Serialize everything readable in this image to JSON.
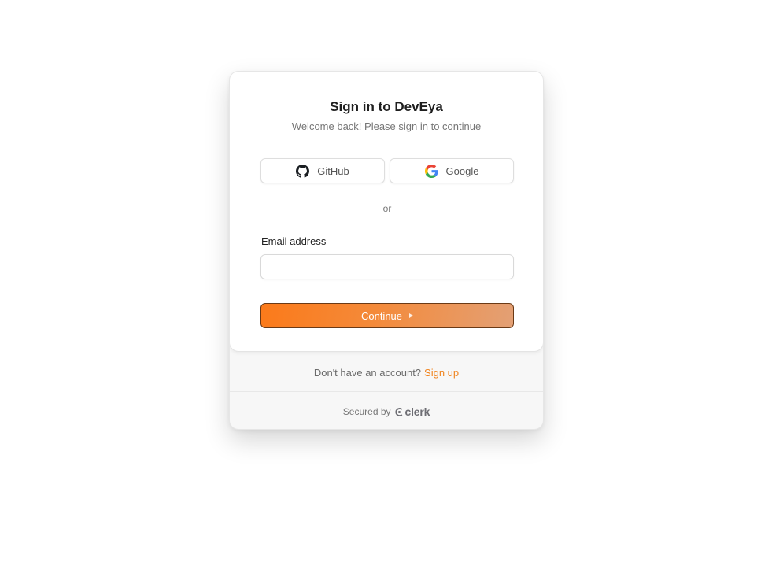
{
  "signin": {
    "title": "Sign in to DevEya",
    "subtitle": "Welcome back! Please sign in to continue",
    "social": {
      "github_label": "GitHub",
      "google_label": "Google"
    },
    "divider_text": "or",
    "email": {
      "label": "Email address",
      "value": "",
      "placeholder": ""
    },
    "continue_label": "Continue"
  },
  "footer": {
    "no_account_text": "Don't have an account?",
    "signup_label": "Sign up",
    "secured_by": "Secured by",
    "clerk_brand": "clerk"
  },
  "colors": {
    "accent": "#f0841f",
    "button_gradient_start": "#fb7a1a",
    "button_gradient_end": "#e3a075"
  }
}
